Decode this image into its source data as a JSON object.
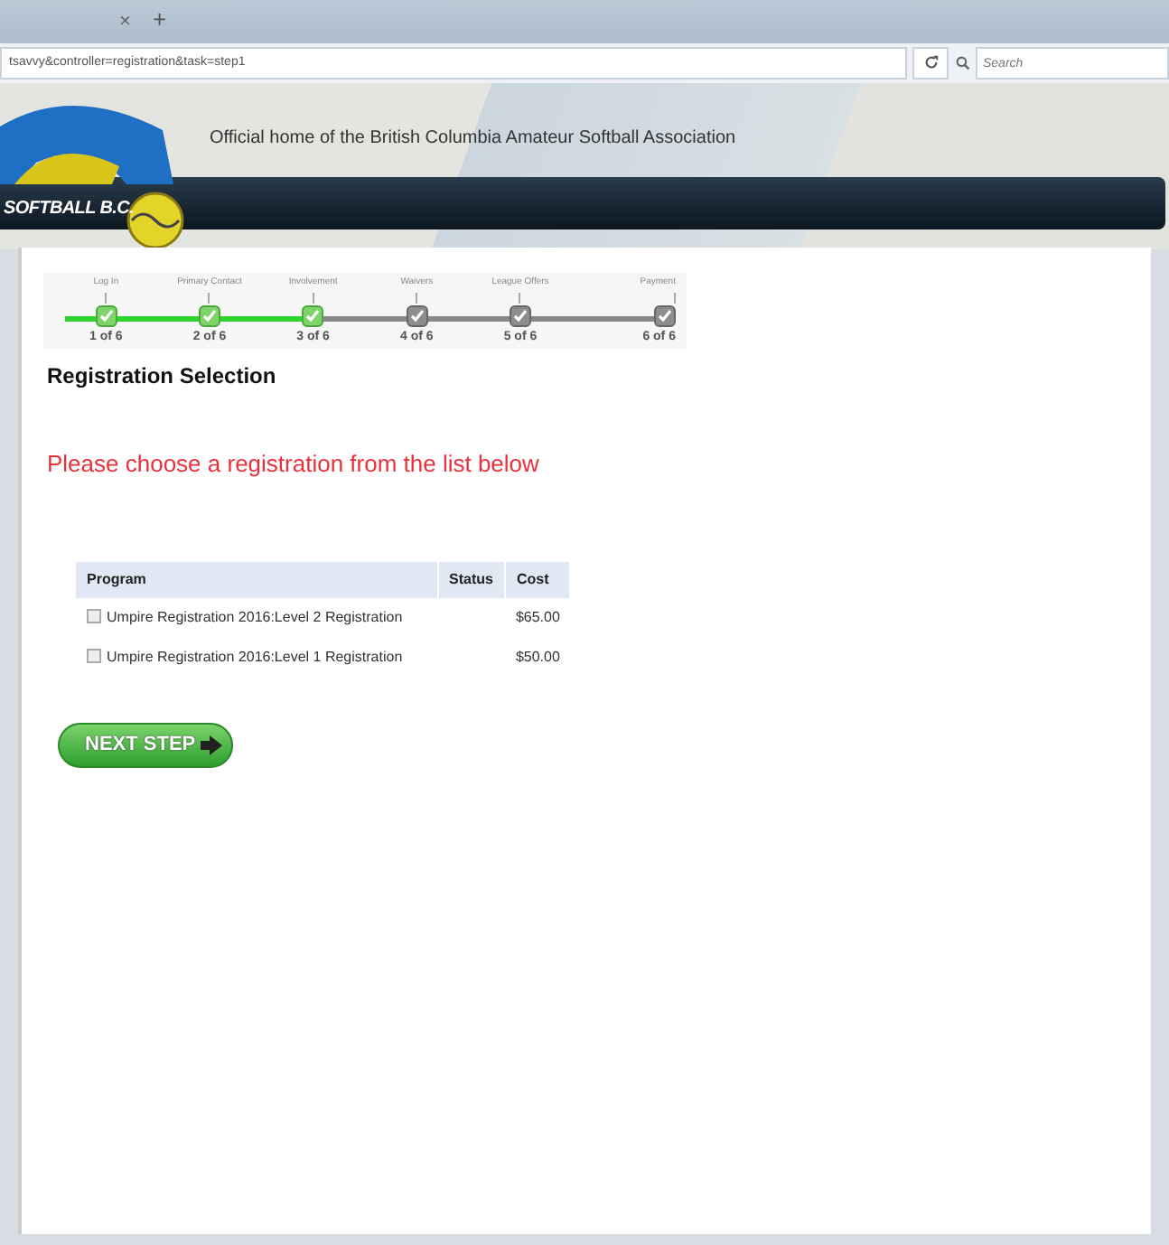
{
  "browser": {
    "tab_close": "×",
    "new_tab": "+",
    "url": "tsavvy&controller=registration&task=step1",
    "search": {
      "placeholder": "Search"
    }
  },
  "header": {
    "logo_text": "SOFTBALL B.C.",
    "tagline": "Official home of the British Columbia Amateur Softball Association"
  },
  "steps": [
    {
      "label": "Log In",
      "count": "1 of 6",
      "completed": true
    },
    {
      "label": "Primary Contact",
      "count": "2 of 6",
      "completed": true
    },
    {
      "label": "Involvement",
      "count": "3 of 6",
      "completed": true
    },
    {
      "label": "Waivers",
      "count": "4 of 6",
      "completed": false
    },
    {
      "label": "League Offers",
      "count": "5 of 6",
      "completed": false
    },
    {
      "label": "Payment",
      "count": "6 of 6",
      "completed": false
    }
  ],
  "heading": "Registration Selection",
  "message": "Please choose a registration from the list below",
  "table": {
    "columns": [
      "Program",
      "Status",
      "Cost"
    ],
    "rows": [
      {
        "program": "Umpire Registration 2016:Level 2 Registration",
        "status": "",
        "cost": "$65.00",
        "checked": false
      },
      {
        "program": "Umpire Registration 2016:Level 1 Registration",
        "status": "",
        "cost": "$50.00",
        "checked": false
      }
    ]
  },
  "next_button": "NEXT STEP"
}
